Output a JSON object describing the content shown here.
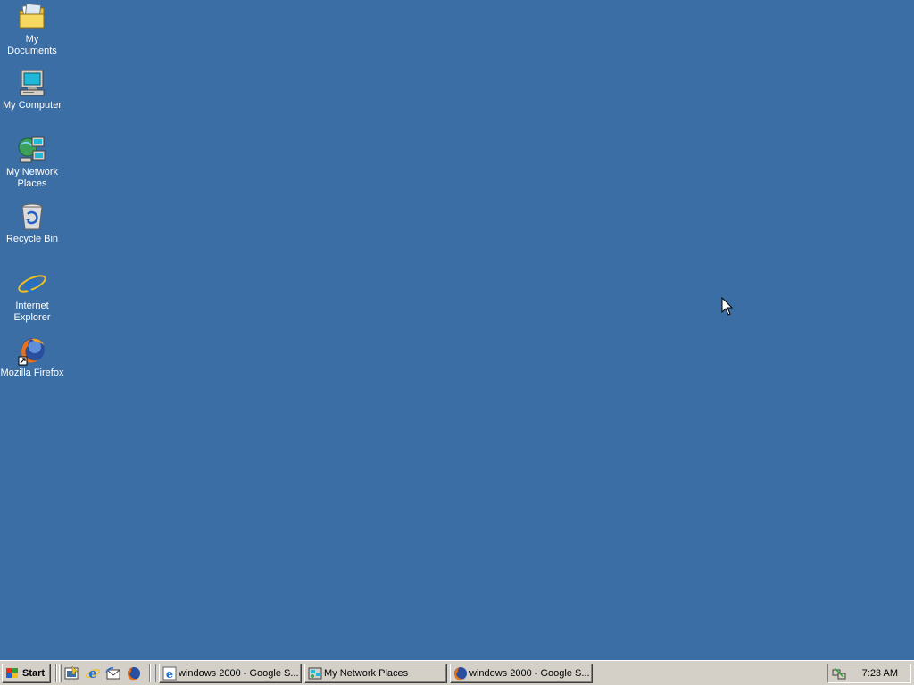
{
  "desktop": {
    "background_color": "#3a6ea5",
    "icons": [
      {
        "label": "My Documents",
        "icon": "folder-documents-icon"
      },
      {
        "label": "My Computer",
        "icon": "computer-icon"
      },
      {
        "label": "My Network\nPlaces",
        "icon": "network-places-icon"
      },
      {
        "label": "Recycle Bin",
        "icon": "recycle-bin-icon"
      },
      {
        "label": "Internet\nExplorer",
        "icon": "internet-explorer-icon"
      },
      {
        "label": "Mozilla Firefox",
        "icon": "firefox-icon"
      }
    ]
  },
  "taskbar": {
    "start_label": "Start",
    "quick_launch": [
      {
        "icon": "show-desktop-icon"
      },
      {
        "icon": "internet-explorer-icon"
      },
      {
        "icon": "outlook-express-icon"
      },
      {
        "icon": "firefox-icon"
      }
    ],
    "tasks": [
      {
        "label": "windows 2000 - Google S...",
        "icon": "internet-explorer-icon"
      },
      {
        "label": "My Network Places",
        "icon": "network-places-icon"
      },
      {
        "label": "windows 2000 - Google S...",
        "icon": "firefox-icon"
      }
    ],
    "tray": {
      "icon": "network-connection-icon",
      "clock": "7:23 AM"
    }
  }
}
